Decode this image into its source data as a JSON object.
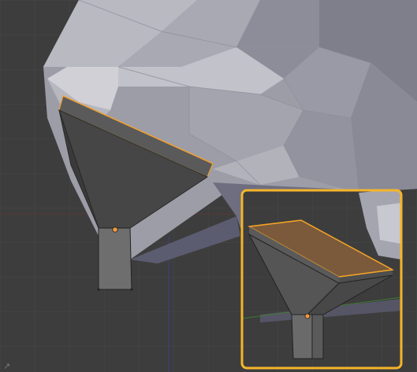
{
  "viewport": {
    "background": "#3d3d3d",
    "grid_color": "#464646",
    "x_axis_color": "#8a3a3a",
    "y_axis_color": "#3f7a2f",
    "z_axis_color": "#3a3f8a"
  },
  "mesh_colors": {
    "rock_light": "#b9b9c2",
    "rock_mid": "#9d9da8",
    "rock_dark": "#7f7f8c",
    "funnel_dark": "#464646",
    "funnel_mid": "#565656",
    "spout": "#6e6e6e",
    "selection": "#f0a030",
    "origin_dot": "#f29a3c",
    "inset_highlight": "#f5a524",
    "inset_face": "#7b5a3c"
  },
  "icons": [
    "corner-widget-icon"
  ]
}
